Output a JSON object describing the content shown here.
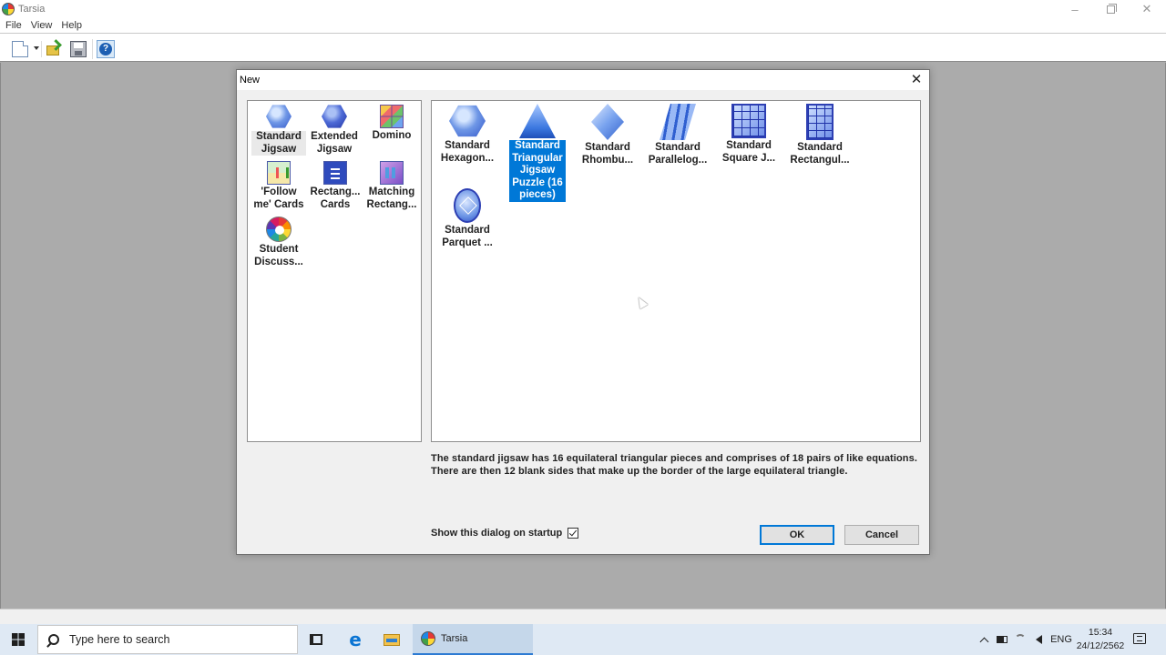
{
  "window": {
    "title": "Tarsia"
  },
  "menu": [
    "File",
    "View",
    "Help"
  ],
  "toolbar": {
    "icons": [
      "new-document-icon",
      "dropdown-arrow-icon",
      "open-folder-icon",
      "save-icon",
      "help-icon"
    ]
  },
  "dialog": {
    "title": "New",
    "categories": [
      {
        "label": "Standard Jigsaw",
        "icon": "standard-jigsaw-icon",
        "selected": true
      },
      {
        "label": "Extended Jigsaw",
        "icon": "extended-jigsaw-icon"
      },
      {
        "label": "Domino",
        "icon": "domino-icon"
      },
      {
        "label": "'Follow me' Cards",
        "icon": "follow-me-cards-icon"
      },
      {
        "label": "Rectang... Cards",
        "icon": "rectangular-cards-icon"
      },
      {
        "label": "Matching Rectang...",
        "icon": "matching-rectangles-icon"
      },
      {
        "label": "Student Discuss...",
        "icon": "student-discussion-icon"
      }
    ],
    "templates": [
      {
        "label": "Standard Hexagon...",
        "icon": "hexagon-jigsaw-icon"
      },
      {
        "label": "Standard Triangular Jigsaw Puzzle (16 pieces)",
        "icon": "triangle-jigsaw-icon",
        "selected": true
      },
      {
        "label": "Standard Rhombu...",
        "icon": "rhombus-jigsaw-icon"
      },
      {
        "label": "Standard Parallelog...",
        "icon": "parallelogram-jigsaw-icon"
      },
      {
        "label": "Standard Square J...",
        "icon": "square-jigsaw-icon"
      },
      {
        "label": "Standard Rectangul...",
        "icon": "rectangular-jigsaw-icon"
      },
      {
        "label": "Standard Parquet ...",
        "icon": "parquet-jigsaw-icon"
      }
    ],
    "description": "The standard jigsaw has 16 equilateral triangular pieces and comprises of 18 pairs of like equations. There are then 12 blank sides that make up the border of the large equilateral triangle.",
    "show_on_startup_label": "Show this dialog on startup",
    "show_on_startup_checked": true,
    "ok_label": "OK",
    "cancel_label": "Cancel"
  },
  "taskbar": {
    "search_placeholder": "Type here to search",
    "running_app": "Tarsia",
    "language": "ENG",
    "time": "15:34",
    "date": "24/12/2562"
  },
  "colors": {
    "selection": "#0078d7",
    "workspace": "#ababab",
    "taskbar": "#dfe9f4"
  }
}
